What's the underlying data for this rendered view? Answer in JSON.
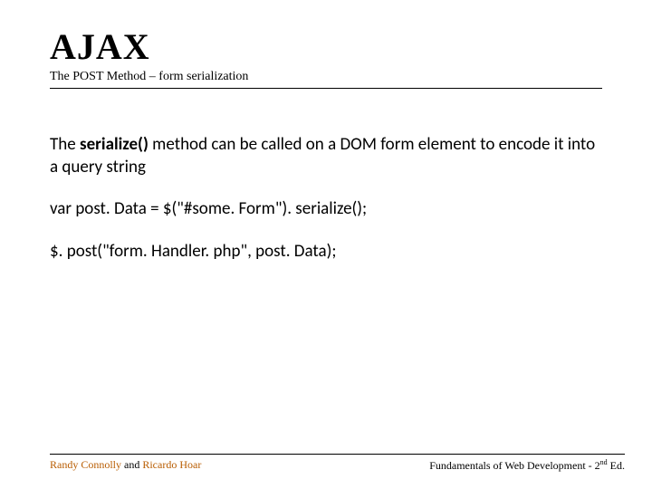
{
  "header": {
    "title": "AJAX",
    "subtitle": "The POST Method – form serialization"
  },
  "body": {
    "para1_pre": " The ",
    "serialize": "serialize()",
    "para1_post": " method can be called on a DOM form element to encode it into a query string",
    "code1": "var post. Data = $(\"#some. Form\"). serialize();",
    "code2": "$. post(\"form. Handler. php\", post. Data);"
  },
  "footer": {
    "author1": "Randy Connolly",
    "and": " and ",
    "author2": "Ricardo Hoar",
    "right_pre": "Fundamentals of Web Development - 2",
    "right_sup": "nd",
    "right_post": " Ed."
  }
}
